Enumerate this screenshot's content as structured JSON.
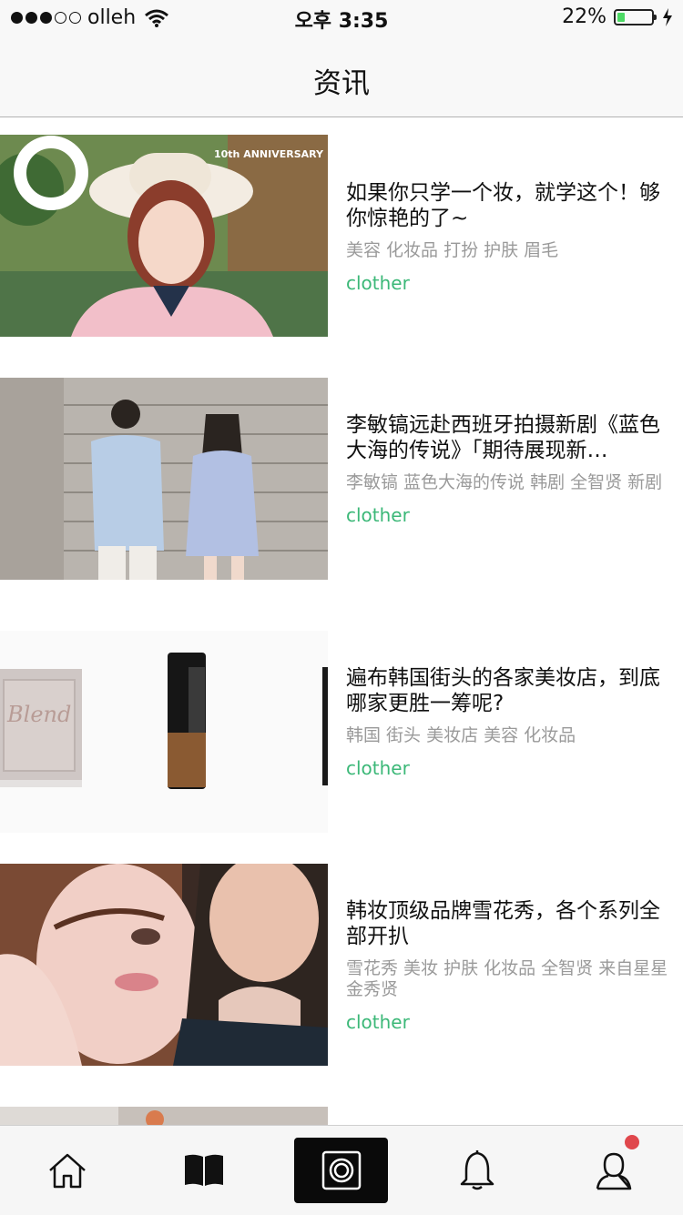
{
  "status_bar": {
    "carrier": "olleh",
    "time": "오후 3:35",
    "battery_percent": "22%",
    "battery_level": 0.22,
    "signal_bars_filled": 3,
    "signal_bars_total": 5
  },
  "nav": {
    "title": "资讯"
  },
  "articles": [
    {
      "title": "如果你只学一个妆，就学这个！够你惊艳的了~",
      "tags": "美容 化妆品 打扮 护肤 眉毛",
      "category": "clother",
      "image_text": "10th ANNIVERSARY"
    },
    {
      "title": "李敏镐远赴西班牙拍摄新剧《蓝色大海的传说》「期待展现新…",
      "tags": "李敏镐 蓝色大海的传说 韩剧 全智贤 新剧",
      "category": "clother"
    },
    {
      "title": "遍布韩国街头的各家美妆店，到底哪家更胜一筹呢?",
      "tags": "韩国 街头 美妆店 美容 化妆品",
      "category": "clother"
    },
    {
      "title": "韩妆顶级品牌雪花秀，各个系列全部开扒",
      "tags": "雪花秀 美妆 护肤 化妆品 全智贤 来自星星 金秀贤",
      "category": "clother"
    }
  ],
  "tabbar": {
    "items": [
      "home-icon",
      "book-icon",
      "camera-icon",
      "bell-icon",
      "profile-icon"
    ],
    "active": "camera-icon",
    "badge_color": "#e0474c"
  },
  "colors": {
    "accent_green": "#3cb878",
    "tag_gray": "#9a9a9a"
  }
}
